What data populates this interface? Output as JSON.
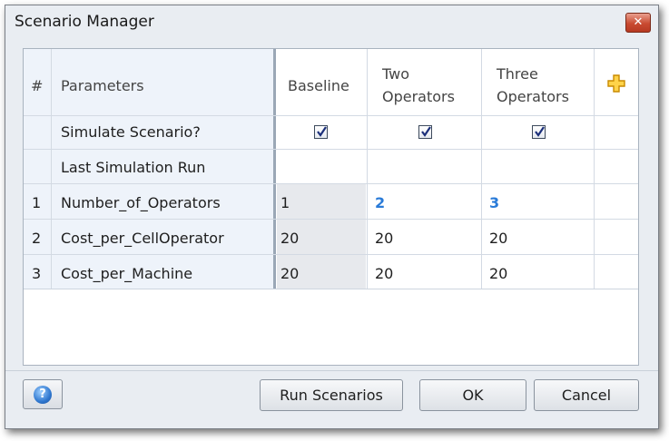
{
  "window": {
    "title": "Scenario Manager",
    "close_icon": "close-icon"
  },
  "grid": {
    "headers": {
      "num": "#",
      "parameters": "Parameters",
      "baseline": "Baseline",
      "two_operators_line1": "Two",
      "two_operators_line2": "Operators",
      "three_operators_line1": "Three",
      "three_operators_line2": "Operators",
      "add_icon": "plus-icon"
    },
    "rows": [
      {
        "num": "",
        "label": "Simulate Scenario?",
        "baseline": "checked",
        "two": "checked",
        "three": "checked"
      },
      {
        "num": "",
        "label": "Last Simulation Run",
        "baseline": "",
        "two": "",
        "three": ""
      },
      {
        "num": "1",
        "label": "Number_of_Operators",
        "baseline": "1",
        "two": "2",
        "three": "3"
      },
      {
        "num": "2",
        "label": "Cost_per_CellOperator",
        "baseline": "20",
        "two": "20",
        "three": "20"
      },
      {
        "num": "3",
        "label": "Cost_per_Machine",
        "baseline": "20",
        "two": "20",
        "three": "20"
      }
    ]
  },
  "buttons": {
    "help": "?",
    "run": "Run Scenarios",
    "ok": "OK",
    "cancel": "Cancel"
  },
  "colors": {
    "highlight": "#2a7bd8",
    "close": "#c94a31"
  }
}
